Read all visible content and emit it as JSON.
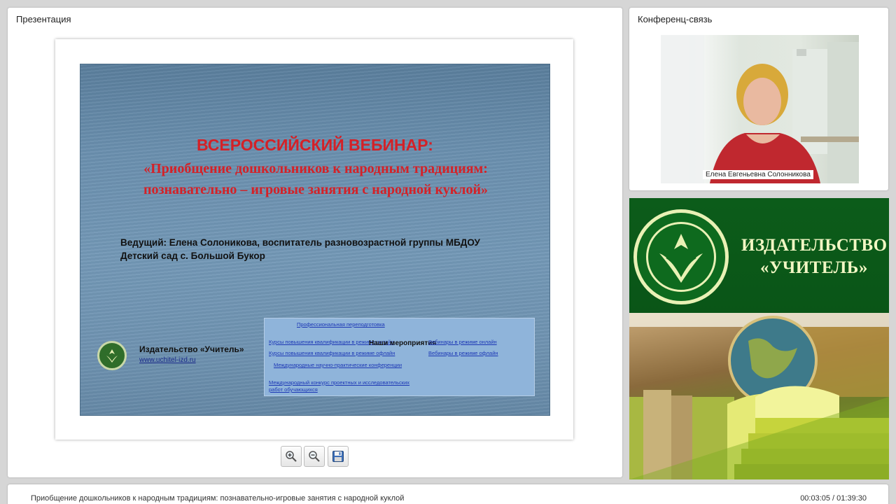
{
  "presentation": {
    "panel_title": "Презентация",
    "slide": {
      "heading": "ВСЕРОССИЙСКИЙ ВЕБИНАР:",
      "subheading": "«Приобщение дошкольников к народным традициям: познавательно – игровые занятия с народной куклой»",
      "host_line1": "Ведущий:  Елена Солоникова, воспитатель разновозрастной группы МБДОУ",
      "host_line2": "Детский сад с. Большой Букор",
      "publisher_name": "Издательство «Учитель»",
      "publisher_url": "www.uchitel-izd.ru",
      "links_box": {
        "title": "Наши мероприятия",
        "link_retraining": "Профессиональная переподготовка",
        "link_courses_online": "Курсы повышения квалификации в режиме онлайн",
        "link_courses_offline": "Курсы повышения квалификации в режиме офлайн",
        "link_webinars_online": "Вебинары в режиме онлайн",
        "link_webinars_offline": "Вебинары в режиме офлайн",
        "link_conferences": "Международные научно-практические конференции",
        "link_contest_line1": "Международный конкурс проектных и исследовательских",
        "link_contest_line2": "работ обучающихся"
      }
    },
    "toolbar": {
      "zoom_in_icon": "zoom-in-icon",
      "zoom_out_icon": "zoom-out-icon",
      "save_icon": "floppy-disk-icon"
    }
  },
  "conference": {
    "panel_title": "Конференц-связь",
    "speaker_name": "Елена Евгеньевна Солонникова"
  },
  "ad": {
    "title_line1": "ИЗДАТЕЛЬСТВО",
    "title_line2": "«УЧИТЕЛЬ»"
  },
  "footer": {
    "title": "Приобщение дошкольников к народным традициям: познавательно-игровые занятия с народной куклой",
    "time": "00:03:05 / 01:39:30"
  },
  "colors": {
    "slide_heading": "#d42127",
    "brand_green": "#0c5c1a",
    "brand_text": "#f2f7c4"
  }
}
